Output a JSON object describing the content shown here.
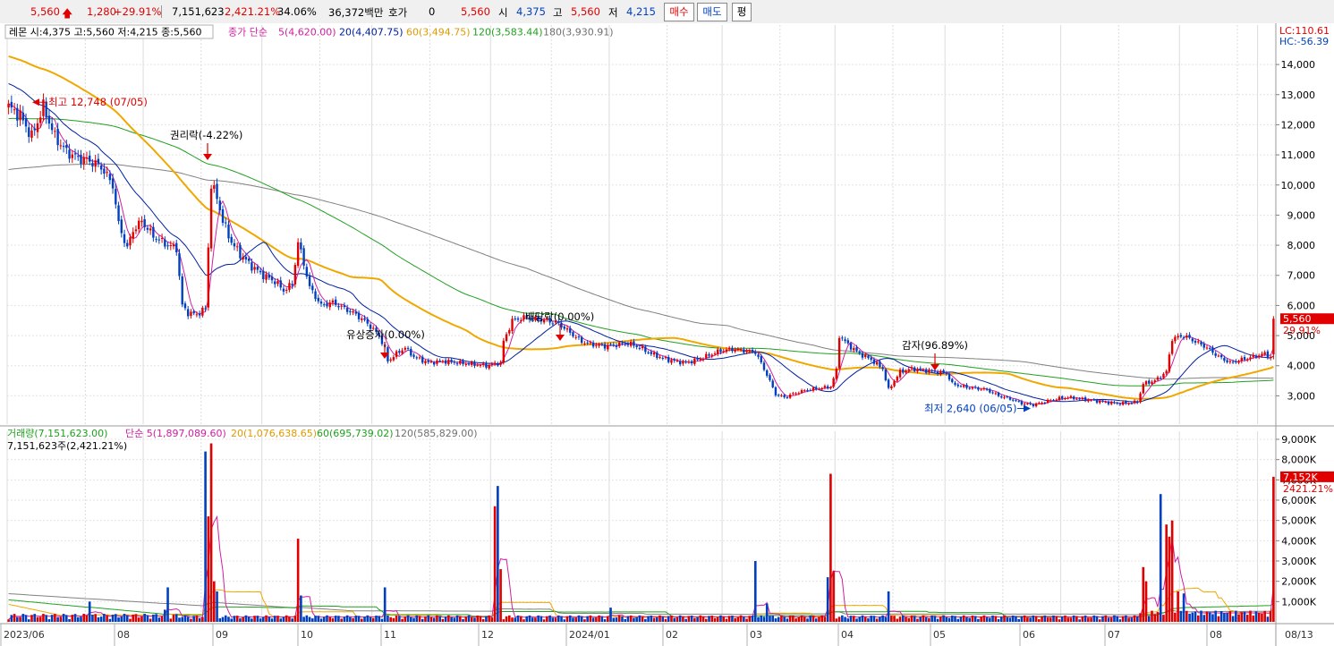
{
  "header": {
    "price": "5,560",
    "change": "1,280",
    "change_pct": "+29.91%",
    "volume": "7,151,623",
    "volume_pct": "2,421.21%",
    "turnover_pct": "34.06%",
    "amount": "36,372백만",
    "hoga_label": "호가",
    "hoga_value": "0",
    "hoga_price": "5,560",
    "open_label": "시",
    "open": "4,375",
    "high_label": "고",
    "high": "5,560",
    "low_label": "저",
    "low": "4,215",
    "buy_button": "매수",
    "sell_button": "매도",
    "eval_button": "평"
  },
  "price_legend": {
    "stock": "레몬 시:4,375 고:5,560 저:4,215 종:5,560",
    "ma_title": "종가 단순",
    "ma5": "5(4,620.00)",
    "ma20": "20(4,407.75)",
    "ma60": "60(3,494.75)",
    "ma120": "120(3,583.44)",
    "ma180": "180(3,930.91)",
    "lc": "LC:110.61",
    "hc": "HC:-56.39"
  },
  "volume_legend": {
    "title": "거래량(7,151,623.00)",
    "ma5": "단순 5(1,897,089.60)",
    "ma20": "20(1,076,638.65)",
    "ma60": "60(695,739.02)",
    "ma120": "120(585,829.00)",
    "current": "7,151,623주(2,421.21%)"
  },
  "colors": {
    "up": "#e00000",
    "down": "#0040c0",
    "ma5": "#d020a0",
    "ma20": "#0020a0",
    "ma60": "#f0a800",
    "ma120": "#20a020",
    "ma180": "#808080"
  },
  "chart_data": [
    {
      "type": "candlestick",
      "price_axis": {
        "ticks": [
          3000,
          4000,
          5000,
          6000,
          7000,
          8000,
          9000,
          10000,
          11000,
          12000,
          13000,
          14000
        ],
        "labels": [
          "3,000",
          "4,000",
          "5,000",
          "6,000",
          "7,000",
          "8,000",
          "9,000",
          "10,000",
          "11,000",
          "12,000",
          "13,000",
          "14,000"
        ],
        "range": [
          2100,
          15000
        ]
      },
      "x_axis_labels": [
        "2023/06",
        "08",
        "09",
        "10",
        "11",
        "12",
        "2024/01",
        "02",
        "03",
        "04",
        "05",
        "06",
        "07",
        "08",
        "08/13"
      ],
      "last_price": {
        "value": 5560,
        "label": "5,560",
        "pct": "29.91%"
      },
      "annotations": [
        {
          "text": "최고 12,748 (07/05)",
          "value": 12748,
          "kind": "high"
        },
        {
          "text": "권리락(-4.22%)",
          "kind": "event"
        },
        {
          "text": "유상증자(0.00%)",
          "kind": "event"
        },
        {
          "text": "배당락(0.00%)",
          "kind": "event"
        },
        {
          "text": "감자(96.89%)",
          "kind": "event"
        },
        {
          "text": "최저 2,640 (06/05)",
          "value": 2640,
          "kind": "low"
        }
      ],
      "close_path_approx": [
        [
          0,
          12600
        ],
        [
          4,
          12300
        ],
        [
          8,
          11600
        ],
        [
          12,
          12600
        ],
        [
          16,
          11600
        ],
        [
          20,
          11100
        ],
        [
          24,
          10900
        ],
        [
          28,
          10800
        ],
        [
          32,
          10600
        ],
        [
          36,
          10000
        ],
        [
          38,
          8700
        ],
        [
          41,
          7900
        ],
        [
          43,
          8500
        ],
        [
          46,
          8800
        ],
        [
          50,
          8300
        ],
        [
          55,
          8000
        ],
        [
          58,
          7900
        ],
        [
          60,
          6000
        ],
        [
          62,
          5750
        ],
        [
          65,
          5700
        ],
        [
          68,
          5900
        ],
        [
          70,
          10000
        ],
        [
          72,
          9600
        ],
        [
          74,
          8800
        ],
        [
          77,
          8100
        ],
        [
          80,
          7700
        ],
        [
          84,
          7300
        ],
        [
          88,
          7000
        ],
        [
          92,
          6800
        ],
        [
          95,
          6500
        ],
        [
          98,
          6700
        ],
        [
          100,
          8100
        ],
        [
          102,
          7400
        ],
        [
          104,
          6600
        ],
        [
          108,
          6000
        ],
        [
          112,
          6100
        ],
        [
          116,
          5900
        ],
        [
          120,
          5700
        ],
        [
          124,
          5400
        ],
        [
          128,
          5000
        ],
        [
          130,
          4550
        ],
        [
          131,
          4150
        ],
        [
          134,
          4400
        ],
        [
          137,
          4600
        ],
        [
          140,
          4300
        ],
        [
          145,
          4100
        ],
        [
          150,
          4150
        ],
        [
          155,
          4100
        ],
        [
          160,
          4050
        ],
        [
          165,
          4000
        ],
        [
          170,
          4100
        ],
        [
          171,
          4800
        ],
        [
          174,
          5500
        ],
        [
          178,
          5600
        ],
        [
          182,
          5550
        ],
        [
          186,
          5500
        ],
        [
          190,
          5400
        ],
        [
          194,
          5100
        ],
        [
          198,
          4800
        ],
        [
          202,
          4700
        ],
        [
          206,
          4650
        ],
        [
          210,
          4700
        ],
        [
          214,
          4750
        ],
        [
          218,
          4600
        ],
        [
          222,
          4400
        ],
        [
          226,
          4250
        ],
        [
          230,
          4150
        ],
        [
          234,
          4100
        ],
        [
          238,
          4200
        ],
        [
          242,
          4350
        ],
        [
          246,
          4500
        ],
        [
          250,
          4550
        ],
        [
          254,
          4500
        ],
        [
          258,
          4450
        ],
        [
          262,
          3700
        ],
        [
          265,
          3050
        ],
        [
          268,
          2950
        ],
        [
          272,
          3100
        ],
        [
          276,
          3200
        ],
        [
          280,
          3250
        ],
        [
          284,
          3300
        ],
        [
          286,
          3850
        ],
        [
          287,
          5000
        ],
        [
          290,
          4700
        ],
        [
          294,
          4400
        ],
        [
          298,
          4200
        ],
        [
          302,
          3900
        ],
        [
          304,
          3200
        ],
        [
          308,
          3800
        ],
        [
          312,
          3900
        ],
        [
          316,
          3850
        ],
        [
          320,
          3800
        ],
        [
          324,
          3750
        ],
        [
          326,
          3400
        ],
        [
          330,
          3300
        ],
        [
          334,
          3250
        ],
        [
          338,
          3200
        ],
        [
          342,
          3000
        ],
        [
          346,
          2900
        ],
        [
          350,
          2750
        ],
        [
          354,
          2700
        ],
        [
          358,
          2800
        ],
        [
          362,
          2900
        ],
        [
          366,
          2950
        ],
        [
          370,
          2900
        ],
        [
          374,
          2850
        ],
        [
          378,
          2800
        ],
        [
          382,
          2750
        ],
        [
          386,
          2750
        ],
        [
          390,
          2800
        ],
        [
          392,
          3400
        ],
        [
          396,
          3500
        ],
        [
          400,
          3800
        ],
        [
          402,
          4900
        ],
        [
          406,
          5000
        ],
        [
          410,
          4800
        ],
        [
          414,
          4600
        ],
        [
          418,
          4300
        ],
        [
          422,
          4100
        ],
        [
          426,
          4200
        ],
        [
          430,
          4300
        ],
        [
          434,
          4400
        ],
        [
          436,
          4280
        ],
        [
          437,
          5560
        ]
      ]
    },
    {
      "type": "bar",
      "name": "거래량",
      "volume_axis": {
        "ticks": [
          1000,
          2000,
          3000,
          4000,
          5000,
          6000,
          7000,
          8000,
          9000
        ],
        "labels": [
          "1,000K",
          "2,000K",
          "3,000K",
          "4,000K",
          "5,000K",
          "6,000K",
          "7,000K",
          "8,000K",
          "9,000K"
        ],
        "unit": "K"
      },
      "last_volume": {
        "label": "7,152K",
        "pct": "2421.21%"
      },
      "spikes_k": [
        [
          28,
          1000
        ],
        [
          54,
          600
        ],
        [
          55,
          1700
        ],
        [
          68,
          8400
        ],
        [
          69,
          5200
        ],
        [
          70,
          8800
        ],
        [
          71,
          2000
        ],
        [
          72,
          1500
        ],
        [
          100,
          4100
        ],
        [
          101,
          1300
        ],
        [
          130,
          1700
        ],
        [
          168,
          5700
        ],
        [
          169,
          6700
        ],
        [
          170,
          2600
        ],
        [
          208,
          700
        ],
        [
          258,
          3000
        ],
        [
          262,
          900
        ],
        [
          283,
          2200
        ],
        [
          284,
          7300
        ],
        [
          285,
          2500
        ],
        [
          304,
          1500
        ],
        [
          392,
          2700
        ],
        [
          393,
          2000
        ],
        [
          398,
          6300
        ],
        [
          400,
          4800
        ],
        [
          401,
          4200
        ],
        [
          402,
          5000
        ],
        [
          404,
          1500
        ],
        [
          406,
          1400
        ],
        [
          437,
          7152
        ]
      ]
    }
  ]
}
